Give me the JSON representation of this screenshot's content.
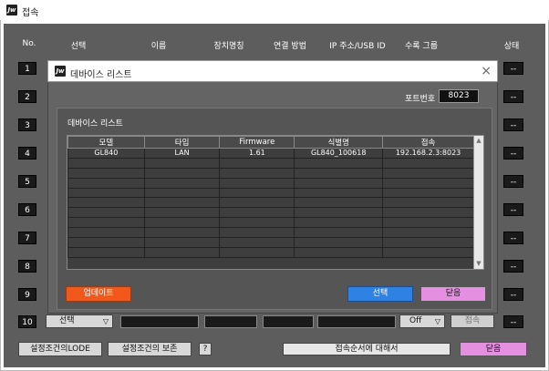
{
  "window": {
    "title": "접속"
  },
  "columns": [
    "No.",
    "선택",
    "이름",
    "장치명칭",
    "연결 방법",
    "IP 주소/USB ID",
    "수록 그룹",
    "상태"
  ],
  "rows": [
    {
      "no": "1",
      "status": "--"
    },
    {
      "no": "2",
      "status": "--"
    },
    {
      "no": "3",
      "status": "--"
    },
    {
      "no": "4",
      "status": "--"
    },
    {
      "no": "5",
      "status": "--"
    },
    {
      "no": "6",
      "status": "--"
    },
    {
      "no": "7",
      "status": "--"
    },
    {
      "no": "8",
      "status": "--"
    },
    {
      "no": "9",
      "status": "--"
    },
    {
      "no": "10",
      "status": "--"
    }
  ],
  "row10": {
    "select_value": "선택",
    "group_value": "Off",
    "connect_label": "접속"
  },
  "bottom": {
    "load_label": "설정조건의LODE",
    "save_label": "설정조건의 보존",
    "help_label": "?",
    "order_label": "접속순서에 대해서",
    "close_label": "닫음"
  },
  "dialog": {
    "title": "데바이스 리스트",
    "port_label": "포트번호",
    "port_value": "8023",
    "section_label": "데바이스 리스트",
    "headers": [
      "모델",
      "타입",
      "Firmware",
      "식별명",
      "접속"
    ],
    "devices": [
      [
        "GL840",
        "LAN",
        "1.61",
        "GL840_100618",
        "192.168.2.3:8023"
      ]
    ],
    "update_label": "업데이트",
    "select_label": "선택",
    "close_label": "닫음"
  },
  "colors": {
    "panel": "#5d5d5d",
    "orange": "#f2581c",
    "blue": "#2e82e4",
    "pink": "#e58fe0"
  }
}
